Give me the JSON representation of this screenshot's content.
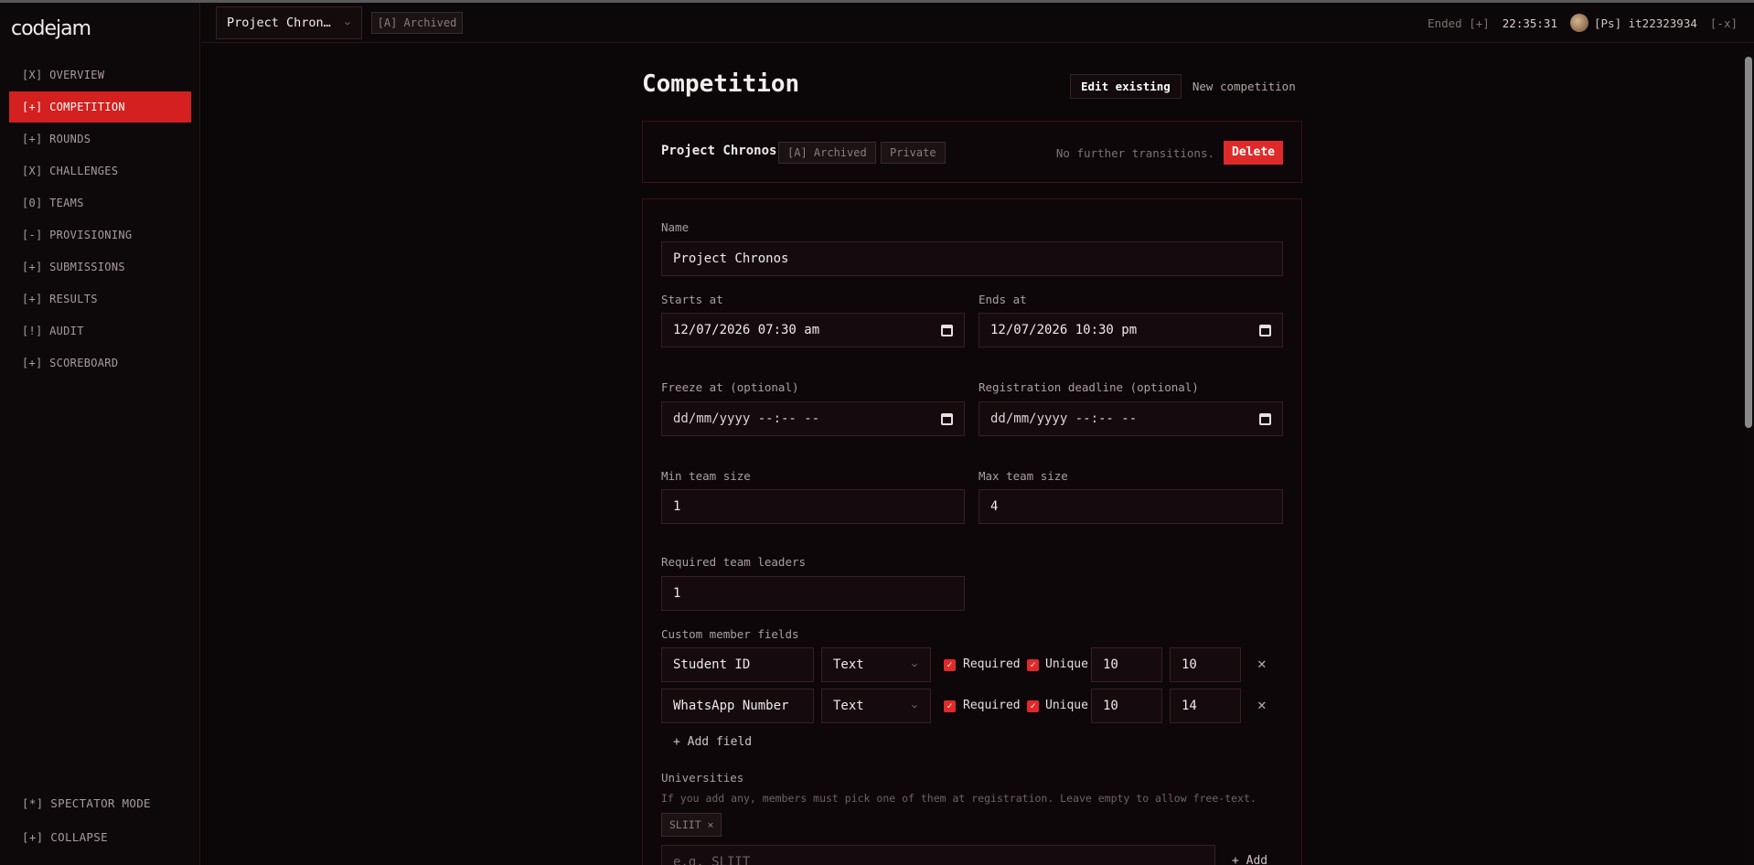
{
  "app": {
    "logo": "codejam"
  },
  "sidebar": {
    "items": [
      {
        "label": "[X] OVERVIEW",
        "active": false
      },
      {
        "label": "[+] COMPETITION",
        "active": true
      },
      {
        "label": "[+] ROUNDS",
        "active": false
      },
      {
        "label": "[X] CHALLENGES",
        "active": false
      },
      {
        "label": "[0] TEAMS",
        "active": false
      },
      {
        "label": "[-] PROVISIONING",
        "active": false
      },
      {
        "label": "[+] SUBMISSIONS",
        "active": false
      },
      {
        "label": "[+] RESULTS",
        "active": false
      },
      {
        "label": "[!] AUDIT",
        "active": false
      },
      {
        "label": "[+] SCOREBOARD",
        "active": false
      }
    ],
    "spectator": "[*] SPECTATOR MODE",
    "collapse": "[+] COLLAPSE"
  },
  "topbar": {
    "competition": "Project Chron…",
    "status": "[A] Archived",
    "ended": "Ended [+]",
    "clock": "22:35:31",
    "user": "[Ps] it22323934",
    "logout": "[-x]"
  },
  "page": {
    "title": "Competition",
    "tabs": {
      "edit": "Edit existing",
      "new": "New competition"
    }
  },
  "header_card": {
    "name": "Project Chronos",
    "archived": "[A] Archived",
    "visibility": "Private",
    "note": "No further transitions.",
    "delete": "Delete"
  },
  "form": {
    "name_label": "Name",
    "name_value": "Project Chronos",
    "starts_label": "Starts at",
    "starts_value": "12/07/2026 07:30 am",
    "ends_label": "Ends at",
    "ends_value": "12/07/2026 10:30 pm",
    "freeze_label": "Freeze at (optional)",
    "freeze_value": "dd/mm/yyyy --:-- --",
    "regdeadline_label": "Registration deadline (optional)",
    "regdeadline_value": "dd/mm/yyyy --:-- --",
    "min_label": "Min team size",
    "min_value": "1",
    "max_label": "Max team size",
    "max_value": "4",
    "leaders_label": "Required team leaders",
    "leaders_value": "1",
    "custom_label": "Custom member fields",
    "custom_fields": [
      {
        "name": "Student ID",
        "type": "Text",
        "required": "Required",
        "unique": "Unique",
        "min": "10",
        "max": "10"
      },
      {
        "name": "WhatsApp Number",
        "type": "Text",
        "required": "Required",
        "unique": "Unique",
        "min": "10",
        "max": "14"
      }
    ],
    "add_field": "+ Add field",
    "universities_label": "Universities",
    "universities_hint": "If you add any, members must pick one of them at registration. Leave empty to allow free-text.",
    "university_tag": "SLIIT ×",
    "university_placeholder": "e.g. SLIIT",
    "add_university": "+ Add"
  },
  "colors": {
    "accent": "#e02a2a",
    "background": "#0b0607"
  }
}
